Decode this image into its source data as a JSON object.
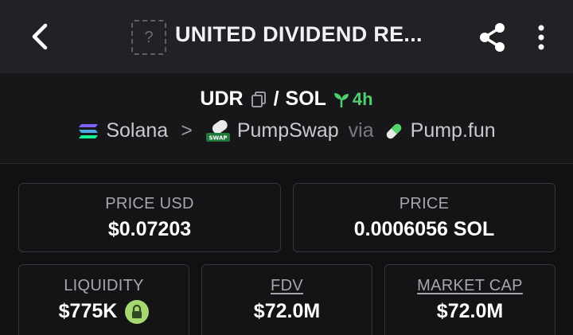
{
  "header": {
    "title": "UNITED DIVIDEND RE...",
    "token_placeholder": "?"
  },
  "pair": {
    "base": "UDR",
    "separator": "/",
    "quote": "SOL",
    "age": "4h"
  },
  "route": {
    "chain": "Solana",
    "arrow": ">",
    "dex": "PumpSwap",
    "via": "via",
    "launchpad": "Pump.fun"
  },
  "stats": {
    "price_usd": {
      "label": "PRICE USD",
      "value": "$0.07203"
    },
    "price": {
      "label": "PRICE",
      "value": "0.0006056 SOL"
    },
    "liquidity": {
      "label": "LIQUIDITY",
      "value": "$775K"
    },
    "fdv": {
      "label": "FDV",
      "value": "$72.0M"
    },
    "market_cap": {
      "label": "MARKET CAP",
      "value": "$72.0M"
    }
  },
  "colors": {
    "accent_green": "#4fcf6e",
    "lock_badge": "#a5d86f",
    "header_bg": "#222226",
    "page_bg": "#111113"
  },
  "icons": [
    "back-arrow-icon",
    "share-icon",
    "more-vertical-icon",
    "copy-icon",
    "sprout-icon",
    "solana-icon",
    "pumpswap-icon",
    "pill-icon",
    "lock-icon"
  ]
}
